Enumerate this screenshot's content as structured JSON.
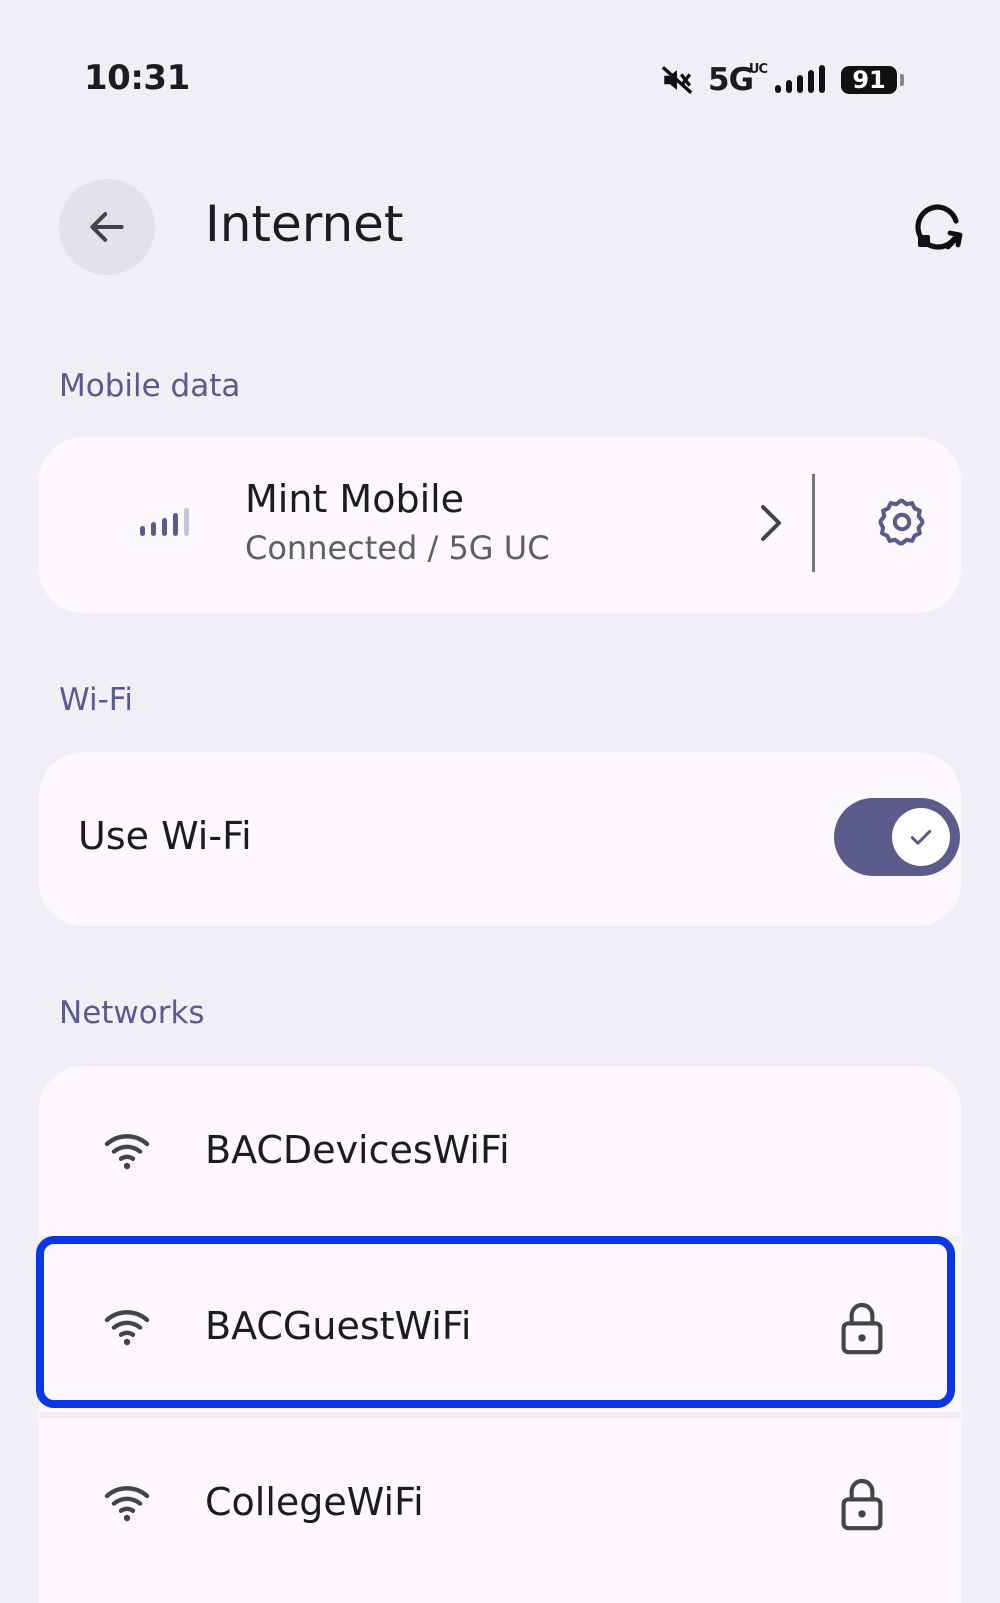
{
  "status_bar": {
    "time": "10:31",
    "network": "5G",
    "network_sup": "UC",
    "battery": "91"
  },
  "header": {
    "title": "Internet",
    "back_icon": "arrow-back-icon",
    "refresh_icon": "refresh-network-icon"
  },
  "sections": {
    "mobile_data": "Mobile data",
    "wifi": "Wi-Fi",
    "networks": "Networks"
  },
  "mobile_data": {
    "carrier": "Mint Mobile",
    "status": "Connected / 5G UC"
  },
  "wifi": {
    "label": "Use Wi-Fi",
    "enabled": true
  },
  "networks": [
    {
      "ssid": "BACDevicesWiFi",
      "locked": false
    },
    {
      "ssid": "BACGuestWiFi",
      "locked": true
    },
    {
      "ssid": "CollegeWiFi",
      "locked": true
    }
  ],
  "colors": {
    "accent": "#5b5b8c",
    "section_label": "#5b5a8c",
    "highlight": "#0a36e8",
    "card": "#fcf8fd",
    "background": "#f1eef6"
  }
}
